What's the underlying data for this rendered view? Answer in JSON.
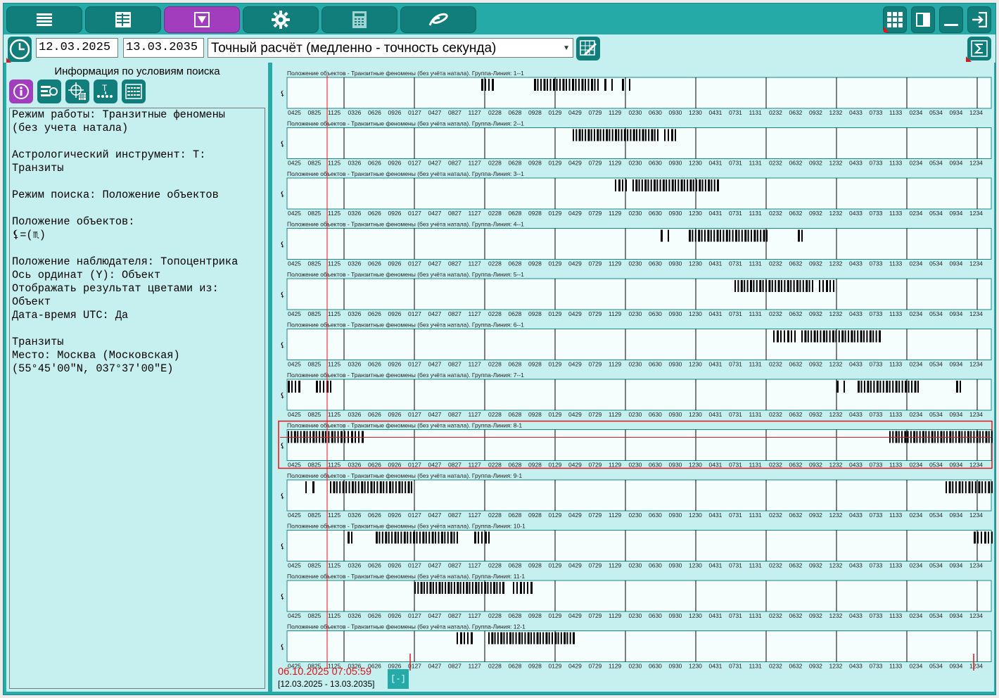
{
  "toolbar": {
    "left_buttons": [
      "menu-icon",
      "list-icon",
      "filter-icon",
      "gear-icon",
      "calculator-icon",
      "logo-icon"
    ],
    "active_index": 2,
    "right_buttons": [
      "grid-icon",
      "panel-icon",
      "minimize-icon",
      "exit-icon"
    ]
  },
  "search": {
    "date_from": "12.03.2025",
    "date_to": "13.03.2035",
    "mode": "Точный расчёт (медленно - точность секунда)"
  },
  "left_panel": {
    "title": "Информация по условиям поиска",
    "buttons": [
      "info-icon",
      "search-settings-icon",
      "target-icon",
      "timeline-icon",
      "list-grid-icon"
    ],
    "info_lines": [
      "Режим работы: Транзитные феномены",
      "(без учета натала)",
      "",
      "Астрологический инструмент: Т:",
      "Транзиты",
      "",
      "Режим поиска: Положение объектов",
      "",
      "Положение объектов:",
      "⚸=(♏)",
      "",
      "Положение наблюдателя: Топоцентрика",
      "Ось ординат (Y): Объект",
      "Отображать результат цветами из:",
      "Объект",
      "Дата-время UTC: Да",
      "",
      "Транзиты",
      "Место: Москва (Московская)",
      "(55°45'00\"N, 037°37'00\"E)"
    ]
  },
  "chart_data": {
    "type": "timeline",
    "row_title_prefix": "Положение объектов - Транзитные феномены (без учёта натала). Группа-Линия: ",
    "row_labels": [
      "1--1",
      "2--1",
      "3--1",
      "4--1",
      "5--1",
      "6--1",
      "7--1",
      "8-1",
      "9-1",
      "10-1",
      "11-1",
      "12-1"
    ],
    "y_symbol": "⚸",
    "x_ticks": [
      "0425",
      "0825",
      "1125",
      "0326",
      "0626",
      "0926",
      "0127",
      "0427",
      "0827",
      "1127",
      "0228",
      "0628",
      "0928",
      "0129",
      "0429",
      "0729",
      "1129",
      "0230",
      "0630",
      "0930",
      "1230",
      "0431",
      "0731",
      "1131",
      "0232",
      "0632",
      "0932",
      "1232",
      "0433",
      "0733",
      "1133",
      "0234",
      "0534",
      "0934",
      "1234"
    ],
    "range_years": [
      2025.19,
      2035.2
    ],
    "selected_row": 7,
    "cursor_date": "06.10.2025 07:05:59",
    "events": [
      [
        [
          2027.95,
          2028.1
        ],
        [
          2028.7,
          2029.6
        ],
        [
          2029.7,
          2029.8
        ],
        [
          2029.95,
          2030.05
        ]
      ],
      [
        [
          2029.25,
          2030.45
        ],
        [
          2030.55,
          2030.7
        ]
      ],
      [
        [
          2029.85,
          2030.0
        ],
        [
          2030.1,
          2031.3
        ]
      ],
      [
        [
          2030.5,
          2030.6
        ],
        [
          2030.9,
          2032.0
        ],
        [
          2032.45,
          2032.5
        ]
      ],
      [
        [
          2031.55,
          2032.65
        ],
        [
          2032.75,
          2032.95
        ]
      ],
      [
        [
          2032.1,
          2032.4
        ],
        [
          2032.5,
          2033.6
        ]
      ],
      [
        [
          2025.2,
          2025.35
        ],
        [
          2025.6,
          2025.8
        ],
        [
          2033.0,
          2033.1
        ],
        [
          2033.3,
          2034.15
        ],
        [
          2034.7,
          2034.75
        ]
      ],
      [
        [
          2025.2,
          2025.95
        ],
        [
          2026.0,
          2026.25
        ],
        [
          2033.75,
          2035.2
        ]
      ],
      [
        [
          2025.45,
          2025.55
        ],
        [
          2025.8,
          2026.95
        ],
        [
          2034.55,
          2035.2
        ]
      ],
      [
        [
          2026.05,
          2026.1
        ],
        [
          2026.45,
          2027.6
        ],
        [
          2027.85,
          2028.05
        ],
        [
          2034.95,
          2035.2
        ]
      ],
      [
        [
          2027.0,
          2028.25
        ],
        [
          2028.4,
          2028.65
        ]
      ],
      [
        [
          2027.6,
          2027.8
        ],
        [
          2028.05,
          2029.25
        ]
      ]
    ],
    "marker_start": "06.10.2025",
    "bottom_range": "[12.03.2025 - 13.03.2035]",
    "collapse_label": "[-]"
  },
  "colors": {
    "teal": "#26aaa8",
    "dark_teal": "#117e7c",
    "purple": "#a23dbe",
    "panel_bg": "#c6efef",
    "red": "#e0141b"
  }
}
